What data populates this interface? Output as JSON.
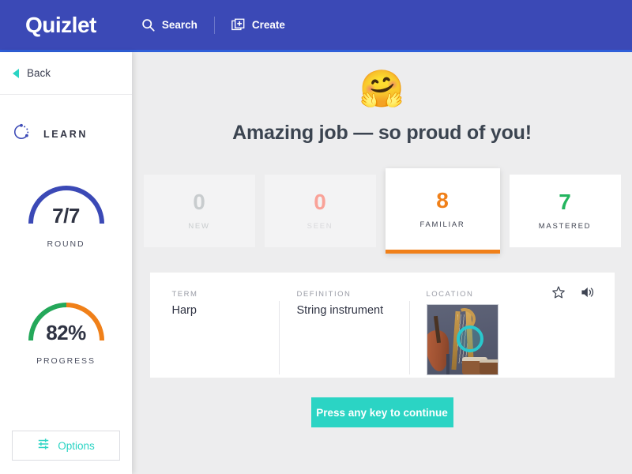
{
  "header": {
    "logo": "Quizlet",
    "search_label": "Search",
    "search_icon": "search-icon",
    "create_label": "Create",
    "create_icon": "create-card-plus-icon",
    "bg_color": "#3b49b6"
  },
  "sidebar": {
    "back_label": "Back",
    "back_icon": "chevron-left-icon",
    "mode_label": "LEARN",
    "mode_icon": "learn-dotted-circle-icon",
    "round_gauge": {
      "value": "7/7",
      "caption": "ROUND",
      "percent": 100,
      "color": "#3b49b6"
    },
    "progress_gauge": {
      "value": "82%",
      "caption": "PROGRESS",
      "percent": 82,
      "left_color": "#24a85a",
      "right_color": "#f08019"
    },
    "options_label": "Options",
    "options_icon": "sliders-icon",
    "accent_color": "#2bd4c4"
  },
  "main": {
    "emoji": "🤗",
    "emoji_name": "hugging-face-emoji",
    "headline": "Amazing job — so proud of you!",
    "stats": [
      {
        "value": "0",
        "label": "NEW",
        "state": "plain",
        "color": "#c8ccce"
      },
      {
        "value": "0",
        "label": "SEEN",
        "state": "seen",
        "color": "#f9a298"
      },
      {
        "value": "8",
        "label": "FAMILIAR",
        "state": "active",
        "color": "#f08019"
      },
      {
        "value": "7",
        "label": "MASTERED",
        "state": "mastered",
        "color": "#24b55f"
      }
    ],
    "term_card": {
      "columns": [
        "TERM",
        "DEFINITION",
        "LOCATION"
      ],
      "term": "Harp",
      "definition": "String instrument",
      "location_image_alt": "orchestra instruments photo with teal circle highlight",
      "star_icon": "star-outline-icon",
      "audio_icon": "speaker-sound-icon"
    },
    "continue_button": "Press any key to continue",
    "continue_color": "#2bd4c4"
  }
}
